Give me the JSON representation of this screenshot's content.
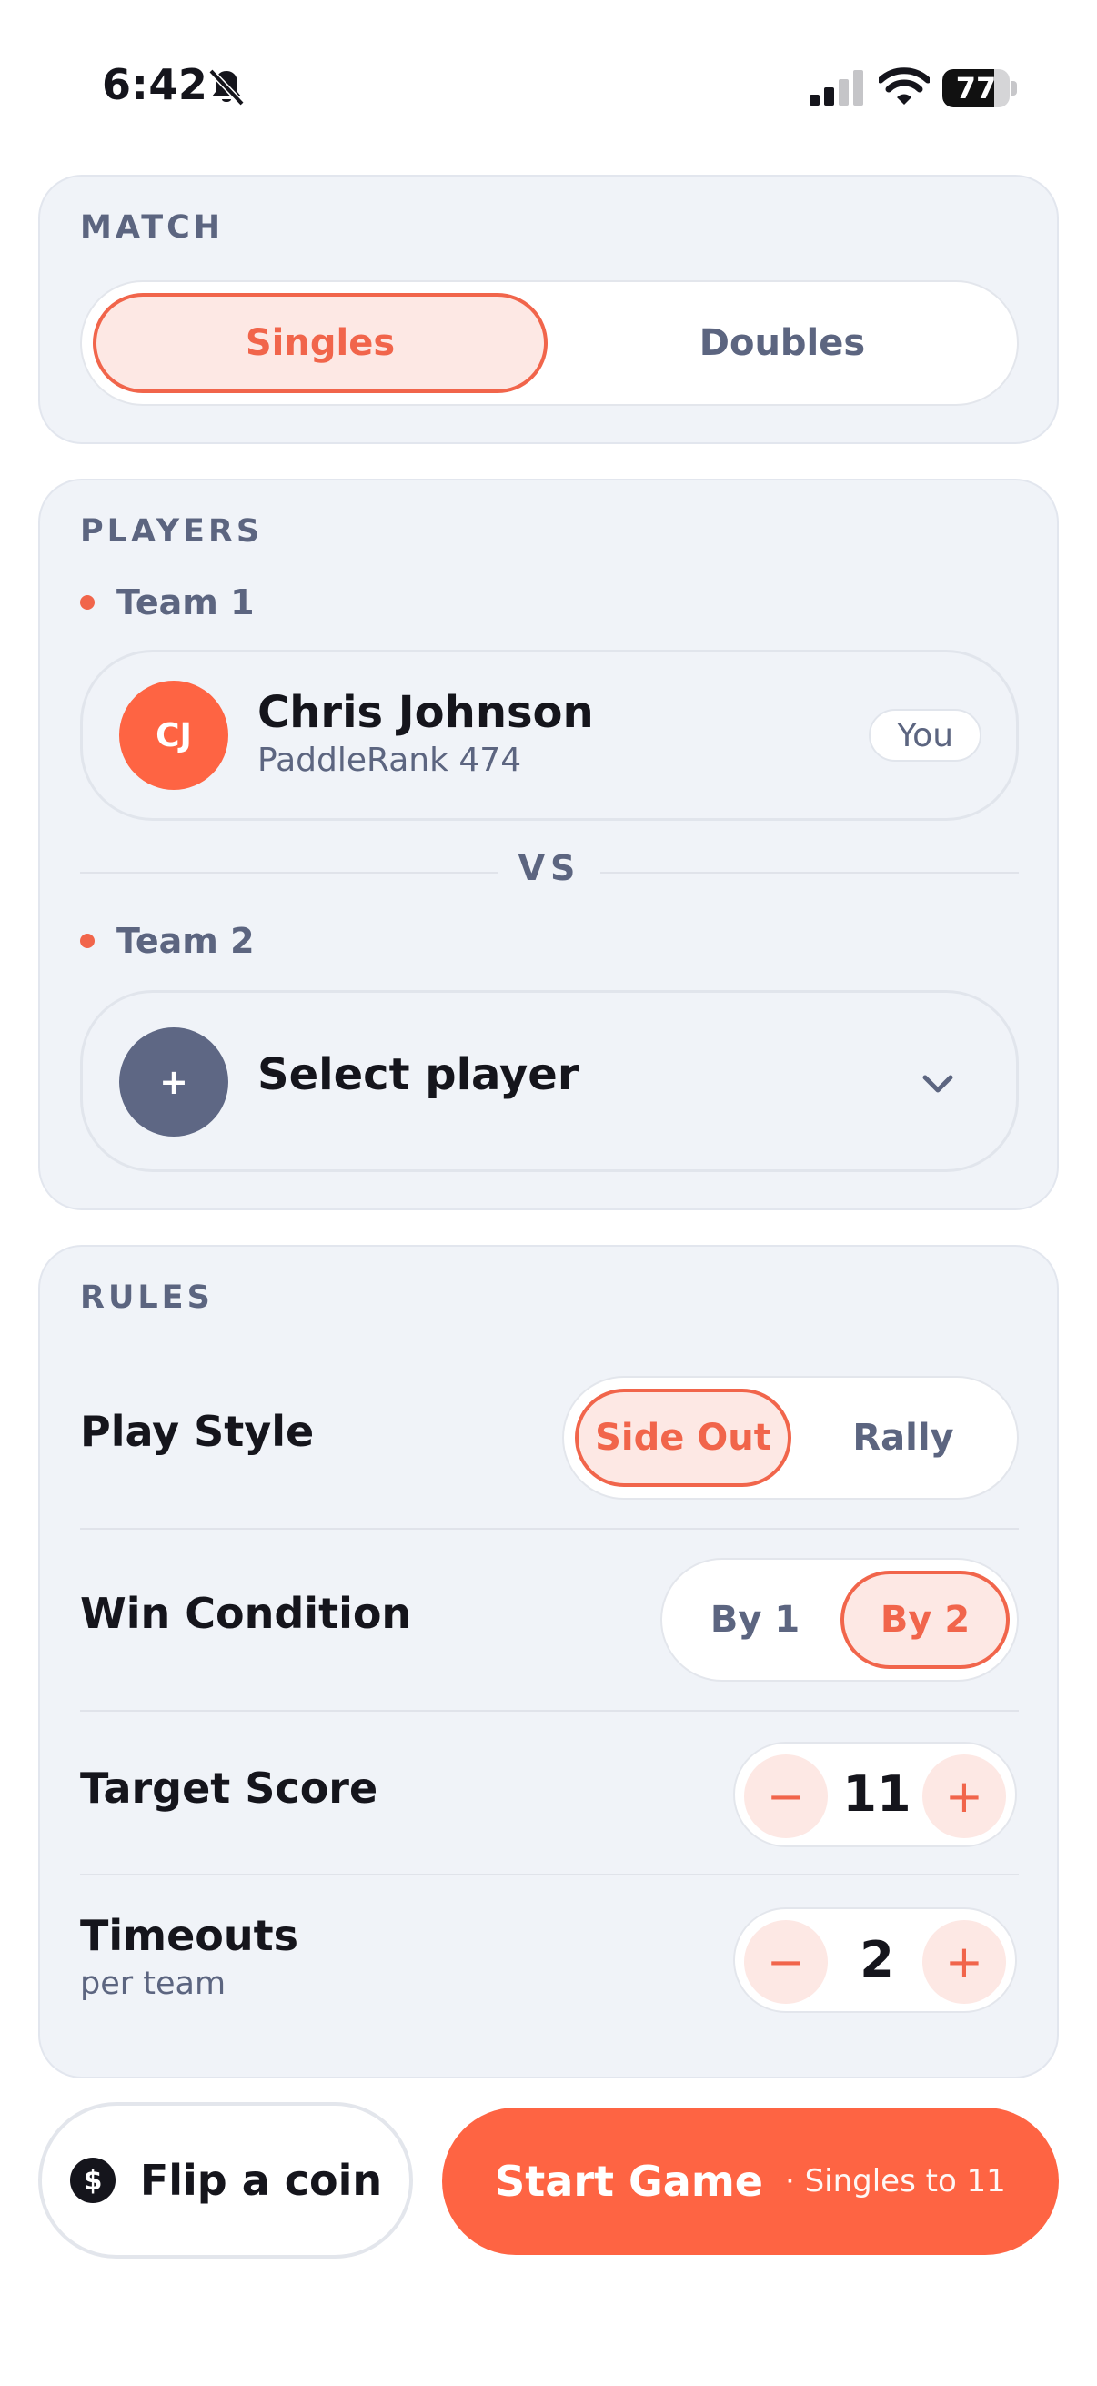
{
  "status_bar": {
    "time": "6:42",
    "battery_level": "77",
    "battery_fraction": 0.77,
    "icons": [
      "bell-slash-icon",
      "cellular-signal-icon",
      "wifi-icon",
      "battery-icon"
    ]
  },
  "match": {
    "section_label": "MATCH",
    "options": [
      "Singles",
      "Doubles"
    ],
    "selected": "Singles"
  },
  "players": {
    "section_label": "PLAYERS",
    "team1": {
      "label": "Team 1",
      "player": {
        "initials": "CJ",
        "name": "Chris Johnson",
        "rank": "PaddleRank 474",
        "badge": "You"
      }
    },
    "vs_label": "VS",
    "team2": {
      "label": "Team 2",
      "select_icon": "+",
      "placeholder": "Select player"
    }
  },
  "rules": {
    "section_label": "RULES",
    "play_style": {
      "label": "Play Style",
      "options": [
        "Side Out",
        "Rally"
      ],
      "selected": "Side Out"
    },
    "win_condition": {
      "label": "Win Condition",
      "options": [
        "By 1",
        "By 2"
      ],
      "selected": "By 2"
    },
    "target_score": {
      "label": "Target Score",
      "value": "11",
      "decrement": "−",
      "increment": "+"
    },
    "timeouts": {
      "label": "Timeouts",
      "sublabel": "per team",
      "value": "2",
      "decrement": "−",
      "increment": "+"
    }
  },
  "actions": {
    "flip_coin": "Flip a coin",
    "start_game": "Start Game",
    "start_game_detail": "· Singles to 11"
  },
  "colors": {
    "accent": "#f1654b",
    "accent_button": "#fe6443",
    "accent_soft": "#fde8e4",
    "card_bg": "#f0f3f8",
    "muted_text": "#5c6580",
    "avatar_empty": "#5e6784"
  }
}
